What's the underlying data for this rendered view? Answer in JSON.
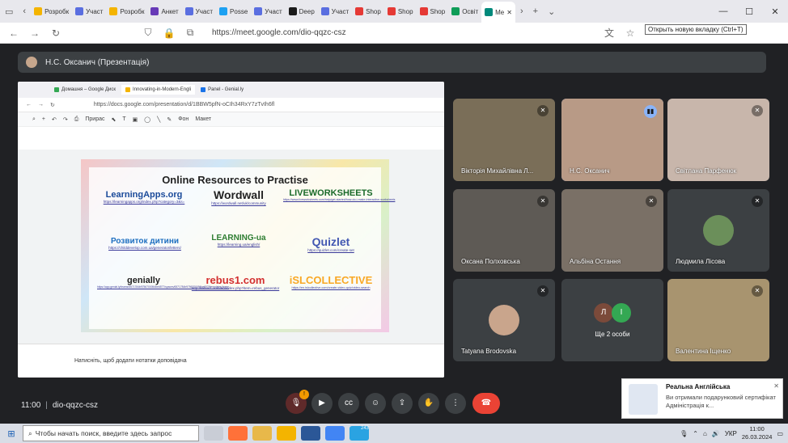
{
  "tabs": [
    {
      "label": "Розробк",
      "color": "#f4b400"
    },
    {
      "label": "Участ",
      "color": "#5a6ee0"
    },
    {
      "label": "Розробк",
      "color": "#f4b400"
    },
    {
      "label": "Анкет",
      "color": "#673ab7"
    },
    {
      "label": "Участ",
      "color": "#5a6ee0"
    },
    {
      "label": "Posse",
      "color": "#1da1f2"
    },
    {
      "label": "Участ",
      "color": "#5a6ee0"
    },
    {
      "label": "Deep",
      "color": "#1a1a1a"
    },
    {
      "label": "Участ",
      "color": "#5a6ee0"
    },
    {
      "label": "Shop",
      "color": "#e53935"
    },
    {
      "label": "Shop",
      "color": "#e53935"
    },
    {
      "label": "Shop",
      "color": "#e53935"
    },
    {
      "label": "Освіт",
      "color": "#0f9d58"
    },
    {
      "label": "Me",
      "color": "#00897b"
    }
  ],
  "address": {
    "url": "https://meet.google.com/dio-qqzc-csz"
  },
  "tooltip": "Открыть новую вкладку (Ctrl+T)",
  "presenter": {
    "name": "Н.С. Оксанич (Презентація)"
  },
  "shared": {
    "tabs": [
      "Домашня – Google Диск",
      "Innovating-in-Modern-Engli",
      "Panel - Genial.ly"
    ],
    "url": "https://docs.google.com/presentation/d/1BBW5pfN-oCIh34RxY7zTvIh6fl",
    "toolbar": {
      "background": "Фон",
      "layout": "Макет",
      "cursor": "Прирас"
    },
    "slide_title": "Online Resources to Practise",
    "resources": [
      {
        "name": "LearningApps.org",
        "link": "https://learningapps.org/index.php?category=3&s="
      },
      {
        "name": "Wordwall",
        "link": "https://wordwall.net/uk/community"
      },
      {
        "name": "LIVEWORKSHEETS",
        "link": "https://www.liveworksheets.com/help/get-started/how-do-i-make-interactive-worksheets"
      },
      {
        "name": "Розвиток дитини",
        "link": "https://childdevelop.com.ua/generator/letters/"
      },
      {
        "name": "LEARNING-ua",
        "link": "https://learning.ua/english/"
      },
      {
        "name": "Quizlet",
        "link": "https://quizlet.com/create-set"
      },
      {
        "name": "genially",
        "link": "https://app.genial.ly/teams/6571784b9756700054be6577/spaces/6571784b9756700054be657f/templates/home"
      },
      {
        "name": "rebus1.com",
        "link": "http://rebus1.com/en/index.php?item=rebus_generator"
      },
      {
        "name": "iSLCOLLECTIVE",
        "link": "https://en.islcollective.com/create-video-quiz/video-search"
      }
    ],
    "notes_placeholder": "Натисніть, щоб додати нотатки доповідача"
  },
  "participants": [
    {
      "name": "Вікторія Михайлівна Л...",
      "muted": true,
      "cam": "#7a6e58"
    },
    {
      "name": "Н.С. Оксанич",
      "muted": false,
      "speaking": true,
      "cam": "#b89a86"
    },
    {
      "name": "Світлана Парфенюк",
      "muted": true,
      "cam": "#c8b6ab"
    },
    {
      "name": "Оксана Полховська",
      "muted": true,
      "cam": "#5e5a55"
    },
    {
      "name": "Альбіна Остання",
      "muted": true,
      "cam": "#7a7066"
    },
    {
      "name": "Людмила Лісова",
      "muted": true,
      "cam": "#3c4043"
    },
    {
      "name": "Tatyana Brodovska",
      "muted": true,
      "cam": "#3c4043"
    },
    {
      "name": "Ще 2 особи",
      "muted": false,
      "cam": "#3c4043"
    },
    {
      "name": "Валентина Іщенко",
      "muted": true,
      "cam": "#a8946f"
    }
  ],
  "more_letters": [
    {
      "letter": "Л",
      "color": "#7b4a3a"
    },
    {
      "letter": "І",
      "color": "#34a853"
    }
  ],
  "meeting": {
    "time": "11:00",
    "separator": "|",
    "code": "dio-qqzc-csz",
    "badge": "!"
  },
  "notification": {
    "title": "Реальна Англійська",
    "message": "Ви отримали подарунковий сертифікат",
    "source": "Адміністрація к..."
  },
  "taskbar": {
    "search_placeholder": "Чтобы начать поиск, введите здесь запрос",
    "lang": "УКР",
    "time": "11:00",
    "date": "26.03.2024",
    "badge": "243"
  }
}
